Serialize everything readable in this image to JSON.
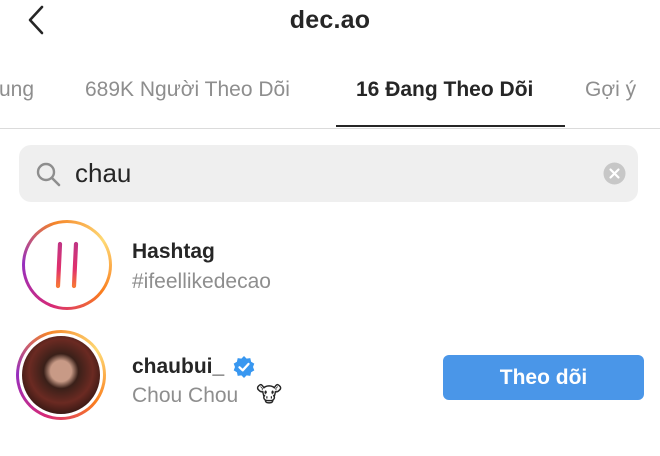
{
  "header": {
    "title": "dec.ao",
    "back_icon": "chevron-left-icon"
  },
  "tabs": [
    {
      "label": "ung",
      "active": false
    },
    {
      "label": "689K Người Theo Dõi",
      "active": false
    },
    {
      "label": "16 Đang Theo Dõi",
      "active": true
    },
    {
      "label": "Gợi ý",
      "active": false
    }
  ],
  "search": {
    "value": "chau",
    "search_icon": "search-icon",
    "clear_icon": "clear-icon"
  },
  "results": [
    {
      "type": "hashtag",
      "title": "Hashtag",
      "subtitle": "#ifeellikedecao",
      "icon": "hashtag-icon"
    },
    {
      "type": "user",
      "username": "chaubui_",
      "verified": true,
      "full_name": "Chou Chou",
      "emoji": "🐮",
      "action_label": "Theo dõi"
    }
  ],
  "colors": {
    "accent_blue": "#4a96e8",
    "text_primary": "#262626",
    "text_secondary": "#8e8e8e",
    "search_bg": "#efefef",
    "verified_blue": "#3897f0"
  }
}
